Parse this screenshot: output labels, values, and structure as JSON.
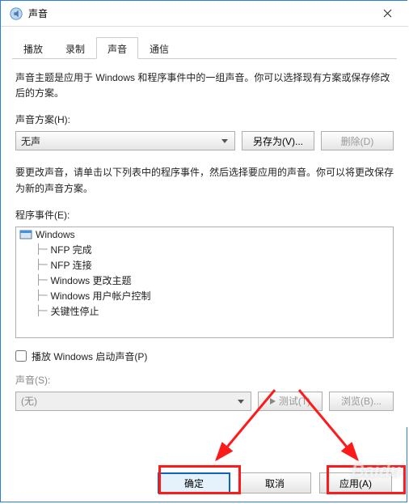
{
  "window": {
    "title": "声音"
  },
  "tabs": {
    "items": [
      {
        "label": "播放"
      },
      {
        "label": "录制"
      },
      {
        "label": "声音"
      },
      {
        "label": "通信"
      }
    ],
    "active_index": 2
  },
  "intro_text": "声音主题是应用于 Windows 和程序事件中的一组声音。你可以选择现有方案或保存修改后的方案。",
  "scheme": {
    "label": "声音方案(H):",
    "selected": "无声",
    "save_as_label": "另存为(V)...",
    "delete_label": "删除(D)"
  },
  "events_intro": "要更改声音，请单击以下列表中的程序事件，然后选择要应用的声音。你可以将更改保存为新的声音方案。",
  "events": {
    "label": "程序事件(E):",
    "root": "Windows",
    "items": [
      "NFP 完成",
      "NFP 连接",
      "Windows 更改主题",
      "Windows 用户帐户控制",
      "关键性停止"
    ]
  },
  "play_startup": {
    "label": "播放 Windows 启动声音(P)",
    "checked": false
  },
  "sound_select": {
    "label": "声音(S):",
    "selected": "(无)",
    "test_label": "测试(T)",
    "browse_label": "浏览(B)..."
  },
  "buttons": {
    "ok": "确定",
    "cancel": "取消",
    "apply": "应用(A)"
  },
  "watermark": "Baidu"
}
